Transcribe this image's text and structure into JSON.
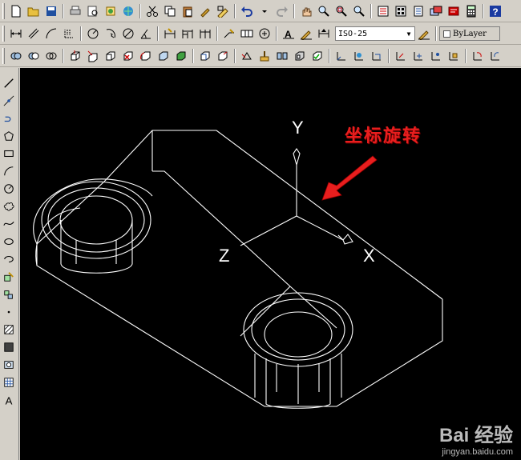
{
  "toolbar_top": {
    "icons": [
      "new-icon",
      "open-icon",
      "save-icon",
      "print-icon",
      "plot-preview-icon",
      "publish-icon",
      "3d-dwf-icon",
      "cut-icon",
      "copy-icon",
      "paste-icon",
      "match-properties-icon",
      "block-editor-icon",
      "undo-icon",
      "redo-icon",
      "pan-icon",
      "zoom-realtime-icon",
      "zoom-window-icon",
      "zoom-previous-icon",
      "properties-icon",
      "design-center-icon",
      "tool-palettes-icon",
      "sheet-set-icon",
      "markup-icon",
      "calculator-icon",
      "help-icon"
    ]
  },
  "toolbar_dim": {
    "text_style": "ISO-25",
    "color_label": "ByLayer"
  },
  "annotation": "坐标旋转",
  "axes": {
    "x": "X",
    "y": "Y",
    "z": "Z"
  },
  "watermark": {
    "brand": "Bai 经验",
    "url": "jingyan.baidu.com"
  },
  "colors": {
    "canvas_bg": "#000000",
    "lines": "#ffffff",
    "annotation": "#e81e1e",
    "toolbar_bg": "#d4d0c8"
  }
}
